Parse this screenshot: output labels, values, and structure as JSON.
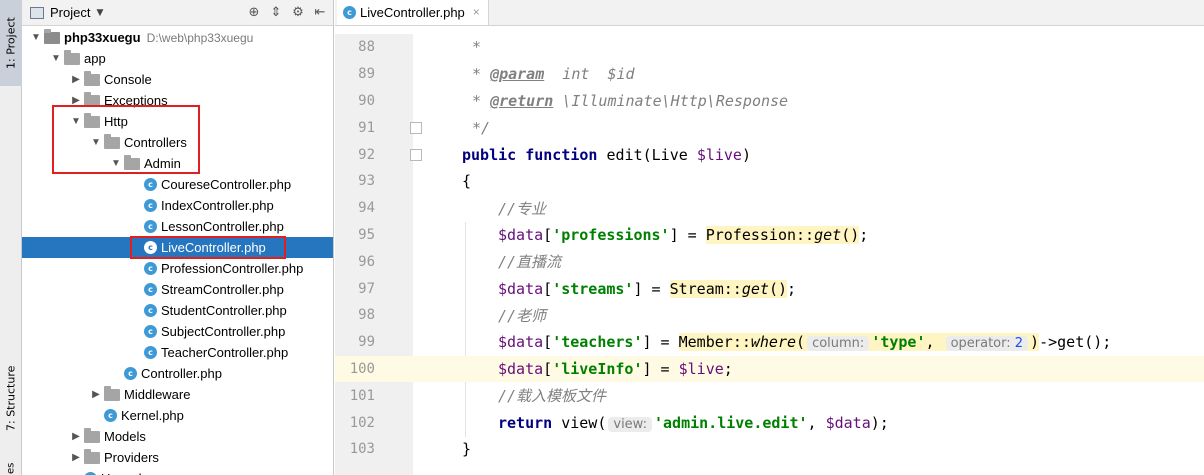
{
  "side_tabs": {
    "project": "1: Project",
    "structure": "7: Structure",
    "favorites": "es"
  },
  "project_panel": {
    "title": "Project",
    "tree": [
      {
        "label": "php33xuegu",
        "hint": "D:\\web\\php33xuegu",
        "type": "folder",
        "level": 0,
        "expanded": true,
        "bold": true
      },
      {
        "label": "app",
        "type": "folder",
        "level": 1,
        "expanded": true
      },
      {
        "label": "Console",
        "type": "folder",
        "level": 2,
        "expanded": false
      },
      {
        "label": "Exceptions",
        "type": "folder",
        "level": 2,
        "expanded": false
      },
      {
        "label": "Http",
        "type": "folder",
        "level": 2,
        "expanded": true
      },
      {
        "label": "Controllers",
        "type": "folder",
        "level": 3,
        "expanded": true
      },
      {
        "label": "Admin",
        "type": "folder",
        "level": 4,
        "expanded": true
      },
      {
        "label": "CoureseController.php",
        "type": "php",
        "level": 5
      },
      {
        "label": "IndexController.php",
        "type": "php",
        "level": 5
      },
      {
        "label": "LessonController.php",
        "type": "php",
        "level": 5
      },
      {
        "label": "LiveController.php",
        "type": "php",
        "level": 5,
        "selected": true
      },
      {
        "label": "ProfessionController.php",
        "type": "php",
        "level": 5
      },
      {
        "label": "StreamController.php",
        "type": "php",
        "level": 5
      },
      {
        "label": "StudentController.php",
        "type": "php",
        "level": 5
      },
      {
        "label": "SubjectController.php",
        "type": "php",
        "level": 5
      },
      {
        "label": "TeacherController.php",
        "type": "php",
        "level": 5
      },
      {
        "label": "Controller.php",
        "type": "php",
        "level": 4
      },
      {
        "label": "Middleware",
        "type": "folder",
        "level": 3,
        "expanded": false
      },
      {
        "label": "Kernel.php",
        "type": "php",
        "level": 3
      },
      {
        "label": "Models",
        "type": "folder",
        "level": 2,
        "expanded": false
      },
      {
        "label": "Providers",
        "type": "folder",
        "level": 2,
        "expanded": false
      },
      {
        "label": "User.php",
        "type": "php",
        "level": 2
      }
    ]
  },
  "editor": {
    "tab_label": "LiveController.php",
    "current_line": 100,
    "lines": [
      {
        "no": "88"
      },
      {
        "no": "89"
      },
      {
        "no": "90"
      },
      {
        "no": "91"
      },
      {
        "no": "92"
      },
      {
        "no": "93"
      },
      {
        "no": "94"
      },
      {
        "no": "95"
      },
      {
        "no": "96"
      },
      {
        "no": "97"
      },
      {
        "no": "98"
      },
      {
        "no": "99"
      },
      {
        "no": "100"
      },
      {
        "no": "101"
      },
      {
        "no": "102"
      },
      {
        "no": "103"
      }
    ],
    "code": {
      "l88_star": "*",
      "l89_star": "* ",
      "l89_tag": "@param",
      "l89_rest": "  int  $id",
      "l90_star": "* ",
      "l90_tag": "@return",
      "l90_rest": " \\Illuminate\\Http\\Response",
      "l91": "*/",
      "l92_kw1": "public",
      "l92_kw2": "function",
      "l92_fn": " edit(Live ",
      "l92_var": "$live",
      "l92_end": ")",
      "l93": "{",
      "l94": "//专业",
      "l95_var": "$data",
      "l95_br1": "[",
      "l95_str": "'professions'",
      "l95_br2": "] = ",
      "l95_cls": "Profession",
      "l95_sep": "::",
      "l95_m": "get",
      "l95_call": "()",
      "l95_end": ";",
      "l96": "//直播流",
      "l97_var": "$data",
      "l97_br1": "[",
      "l97_str": "'streams'",
      "l97_br2": "] = ",
      "l97_cls": "Stream",
      "l97_sep": "::",
      "l97_m": "get",
      "l97_call": "()",
      "l97_end": ";",
      "l98": "//老师",
      "l99_var": "$data",
      "l99_br1": "[",
      "l99_str": "'teachers'",
      "l99_br2": "] = ",
      "l99_cls": "Member",
      "l99_sep": "::",
      "l99_m": "where",
      "l99_open": "(",
      "l99_hint1": "column:",
      "l99_str2": "'type'",
      "l99_comma": ",",
      "l99_hint2": "operator:",
      "l99_num": "2",
      "l99_close": ")",
      "l99_rest": "->get();",
      "l100_var": "$data",
      "l100_br1": "[",
      "l100_str": "'liveInfo'",
      "l100_br2": "] = ",
      "l100_var2": "$live",
      "l100_end": ";",
      "l101": "//载入模板文件",
      "l102_kw": "return",
      "l102_fn": " view(",
      "l102_hint": "view:",
      "l102_str": "'admin.live.edit'",
      "l102_mid": ", ",
      "l102_var": "$data",
      "l102_end": ");",
      "l103": "}"
    }
  }
}
